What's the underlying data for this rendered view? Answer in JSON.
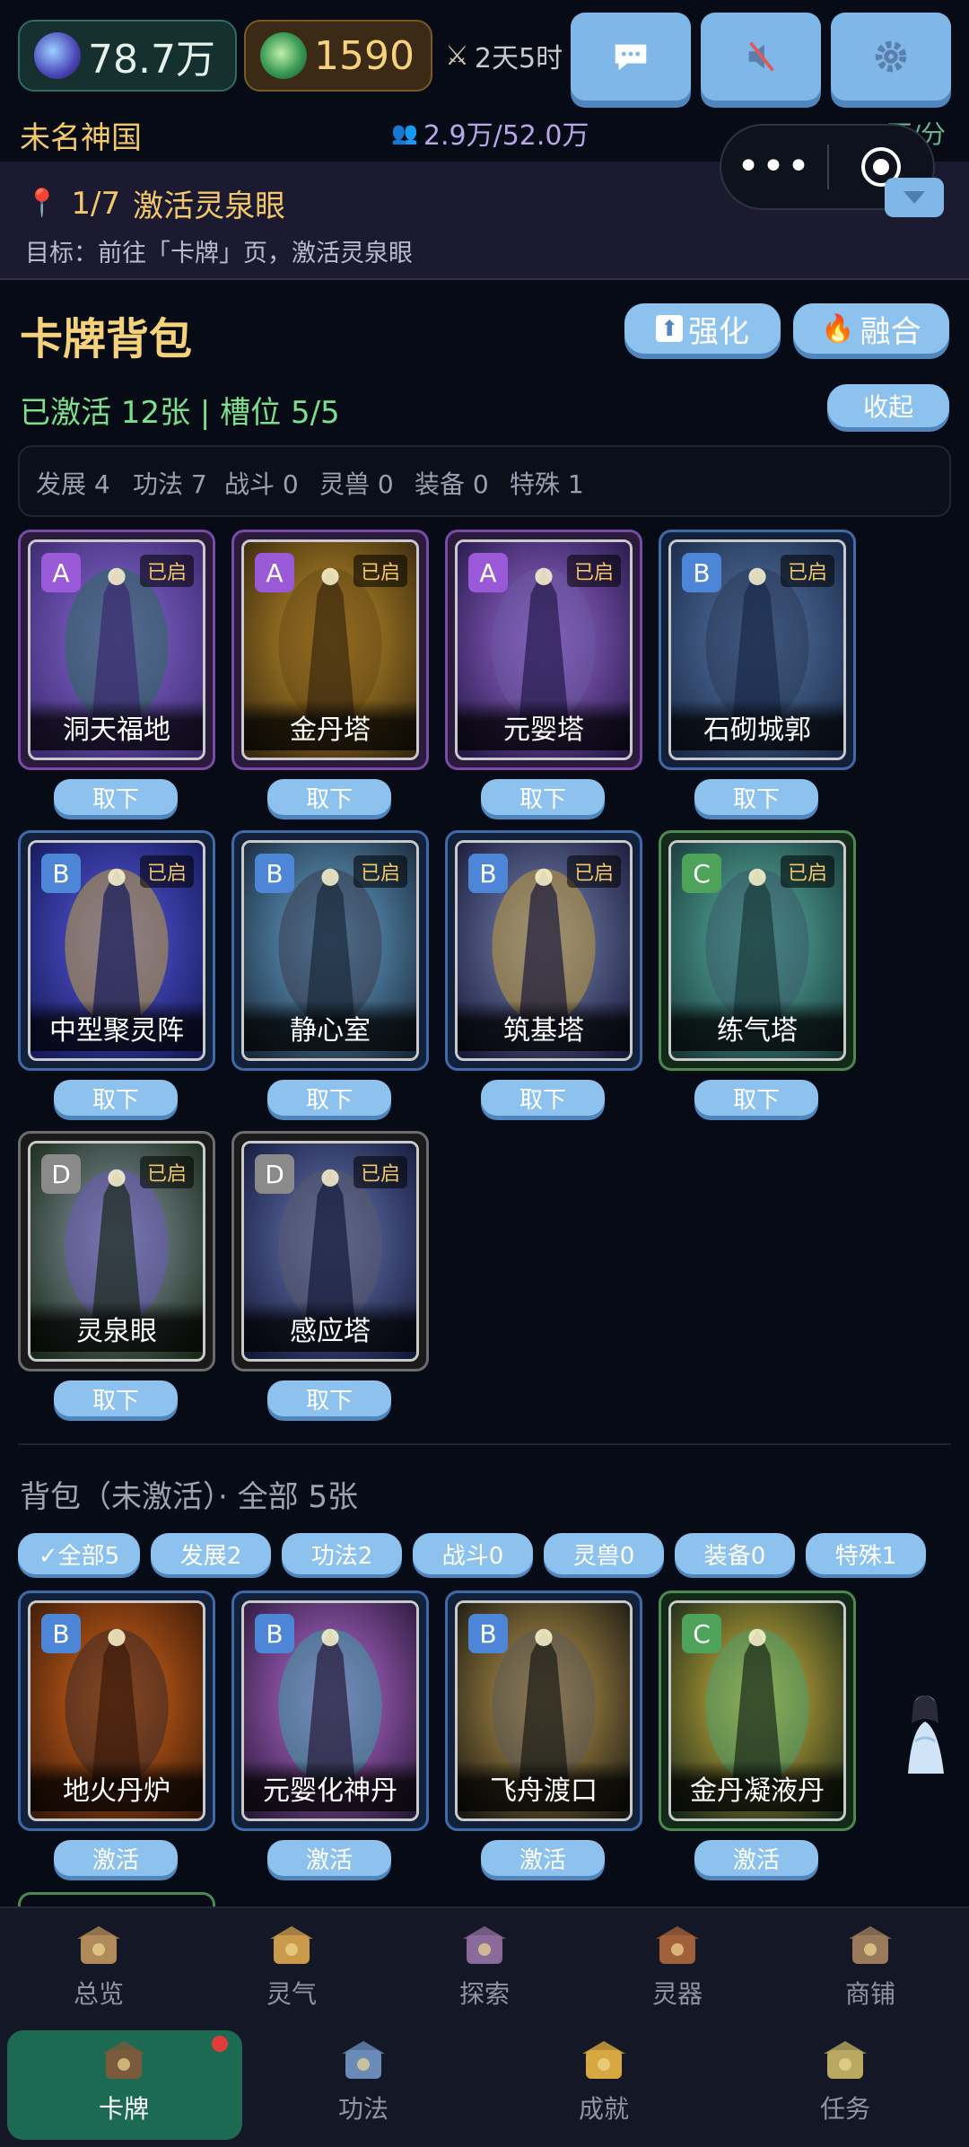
{
  "header": {
    "essence_value": "78.7万",
    "jade_value": "1590",
    "timer": "2天5时",
    "kingdom_name": "未名神国",
    "population": "2.9万/52.0万",
    "rate": "+5.2万/分",
    "capsule_dots": "•••"
  },
  "quest": {
    "progress": "1/7",
    "name": "激活灵泉眼",
    "goal": "目标：前往「卡牌」页，激活灵泉眼"
  },
  "deck": {
    "title": "卡牌背包",
    "upgrade_label": "强化",
    "fuse_label": "融合",
    "activated_summary": "已激活 12张 | 槽位 5/5",
    "collapse_label": "收起",
    "category_counts": [
      "发展 4",
      "功法 7",
      "战斗 0",
      "灵兽 0",
      "装备 0",
      "特殊 1"
    ],
    "on_label": "已启",
    "remove_label": "取下",
    "cards": [
      {
        "grade": "A",
        "name": "洞天福地"
      },
      {
        "grade": "A",
        "name": "金丹塔"
      },
      {
        "grade": "A",
        "name": "元婴塔"
      },
      {
        "grade": "B",
        "name": "石砌城郭"
      },
      {
        "grade": "B",
        "name": "中型聚灵阵"
      },
      {
        "grade": "B",
        "name": "静心室"
      },
      {
        "grade": "B",
        "name": "筑基塔"
      },
      {
        "grade": "C",
        "name": "练气塔"
      },
      {
        "grade": "D",
        "name": "灵泉眼"
      },
      {
        "grade": "D",
        "name": "感应塔"
      }
    ]
  },
  "bag": {
    "title": "背包（未激活）· 全部 5张",
    "filters": [
      "✓全部5",
      "发展2",
      "功法2",
      "战斗0",
      "灵兽0",
      "装备0",
      "特殊1"
    ],
    "activate_label": "激活",
    "cards": [
      {
        "grade": "B",
        "name": "地火丹炉"
      },
      {
        "grade": "B",
        "name": "元婴化神丹"
      },
      {
        "grade": "B",
        "name": "飞舟渡口"
      },
      {
        "grade": "C",
        "name": "金丹凝液丹"
      }
    ]
  },
  "nav": {
    "row1": [
      "总览",
      "灵气",
      "探索",
      "灵器",
      "商铺"
    ],
    "row2": [
      "卡牌",
      "功法",
      "成就",
      "任务"
    ]
  },
  "colors": {
    "background": "#070b16",
    "accent_blue": "#8dc2ef",
    "gold": "#f6d27a",
    "green": "#7be08c",
    "grade_A": "#9a5ad8",
    "grade_B": "#4d86d6",
    "grade_C": "#4ea35a",
    "grade_D": "#8a8a8a"
  }
}
